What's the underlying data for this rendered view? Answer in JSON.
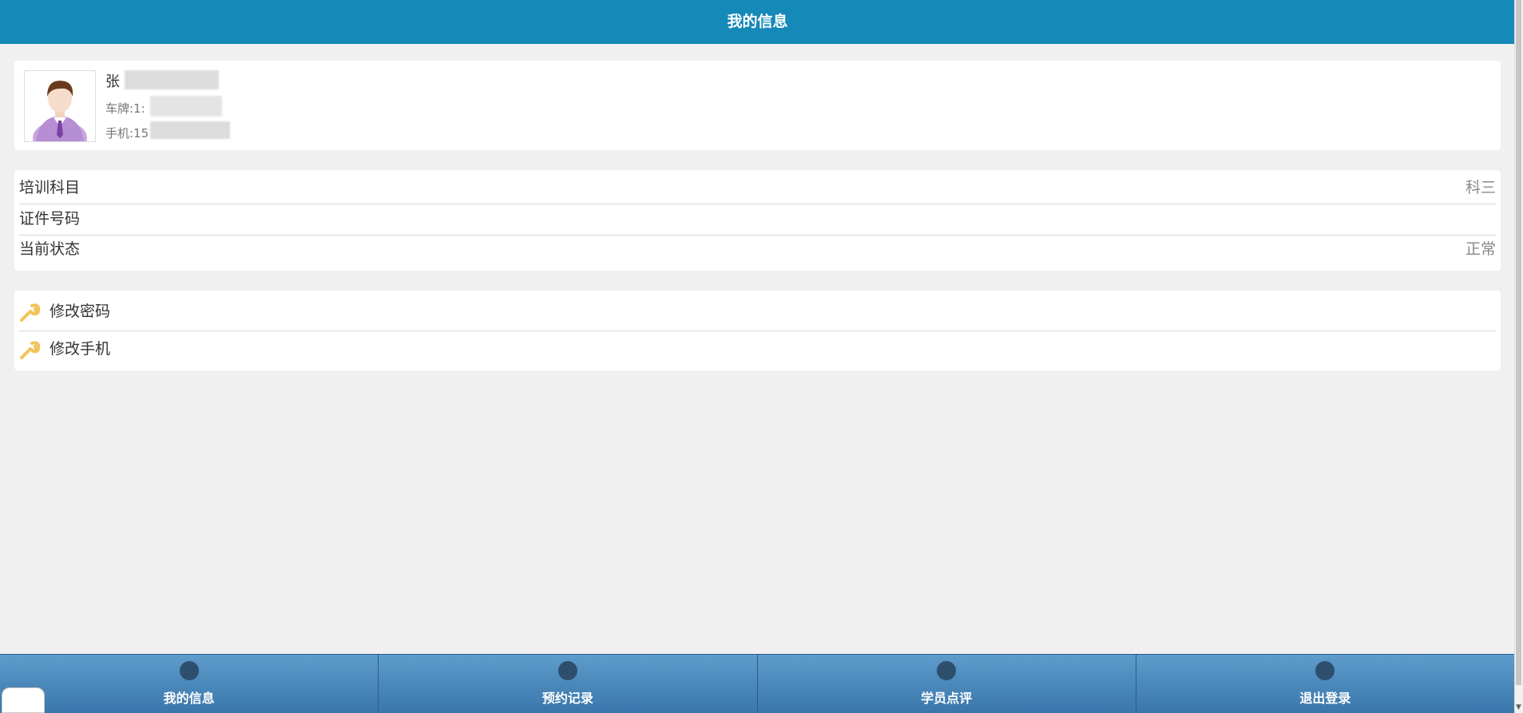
{
  "header": {
    "title": "我的信息"
  },
  "profile": {
    "name": "张",
    "plate": "车牌:1:",
    "phone": "手机:15"
  },
  "info": {
    "rows": [
      {
        "label": "培训科目",
        "value": "科三"
      },
      {
        "label": "证件号码",
        "value": ""
      },
      {
        "label": "当前状态",
        "value": "正常"
      }
    ]
  },
  "actions": [
    {
      "label": "修改密码",
      "icon": "wrench-icon"
    },
    {
      "label": "修改手机",
      "icon": "wrench-icon"
    }
  ],
  "footer": {
    "tabs": [
      {
        "label": "我的信息",
        "icon": "circle-icon"
      },
      {
        "label": "预约记录",
        "icon": "circle-icon"
      },
      {
        "label": "学员点评",
        "icon": "circle-icon"
      },
      {
        "label": "退出登录",
        "icon": "circle-icon"
      }
    ]
  },
  "colors": {
    "header": "#1589b8",
    "footer_top": "#5d9ccb",
    "footer_bottom": "#3a76ab",
    "icon_dot": "#2d4f6d",
    "wrench": "#f4c35a"
  }
}
